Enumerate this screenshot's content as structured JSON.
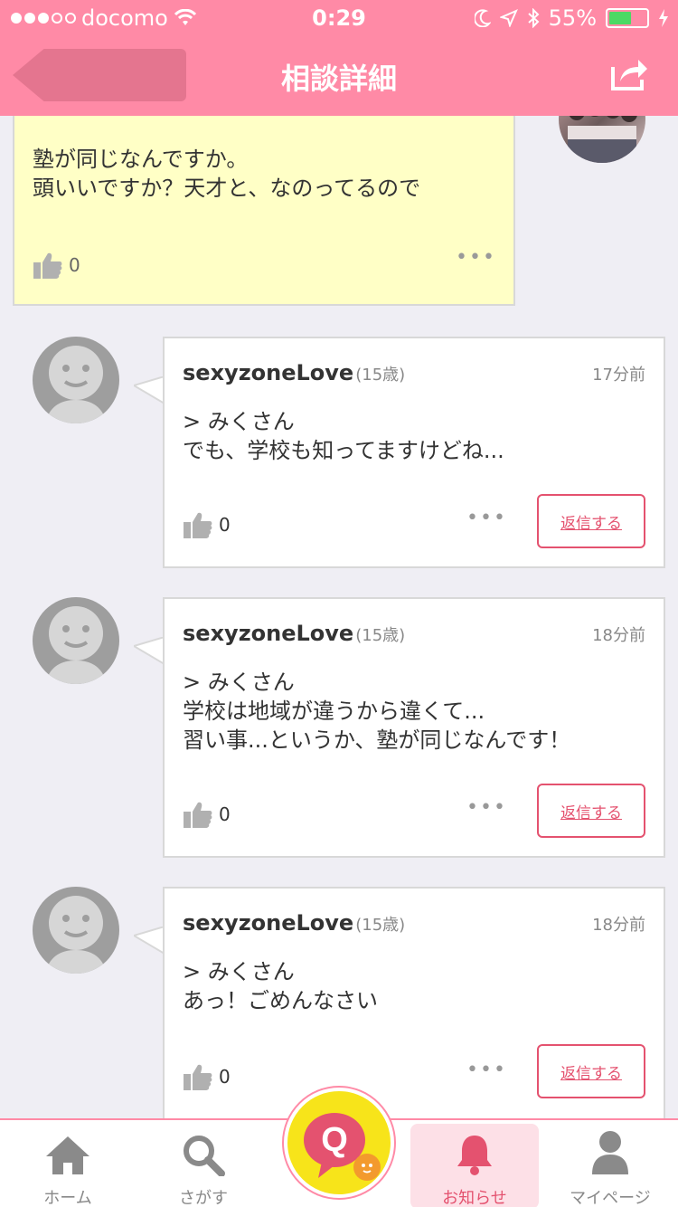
{
  "status_bar": {
    "carrier": "docomo",
    "time": "0:29",
    "battery": "55%"
  },
  "nav": {
    "title": "相談詳細"
  },
  "top_post": {
    "text_line1": "塾が同じなんですか。",
    "text_line2": "頭いいですか？天才と、なのってるので",
    "likes": "0",
    "more": "•••"
  },
  "replies": [
    {
      "name": "sexyzoneLove",
      "age": "(15歳)",
      "time": "17分前",
      "text": "> みくさん\nでも、学校も知ってますけどね...",
      "likes": "0",
      "more": "•••",
      "reply_label": "返信する"
    },
    {
      "name": "sexyzoneLove",
      "age": "(15歳)",
      "time": "18分前",
      "text": "> みくさん\n学校は地域が違うから違くて...\n習い事...というか、塾が同じなんです！",
      "likes": "0",
      "more": "•••",
      "reply_label": "返信する"
    },
    {
      "name": "sexyzoneLove",
      "age": "(15歳)",
      "time": "18分前",
      "text": "> みくさん\nあっ！ごめんなさい",
      "likes": "0",
      "more": "•••",
      "reply_label": "返信する"
    }
  ],
  "tabbar": {
    "home": "ホーム",
    "search": "さがす",
    "notifications": "お知らせ",
    "mypage": "マイページ",
    "active": "notifications"
  },
  "colors": {
    "header": "#ff8aa6",
    "accent": "#e4526f",
    "highlight_card": "#ffffc6",
    "q_button": "#f7e41a"
  }
}
